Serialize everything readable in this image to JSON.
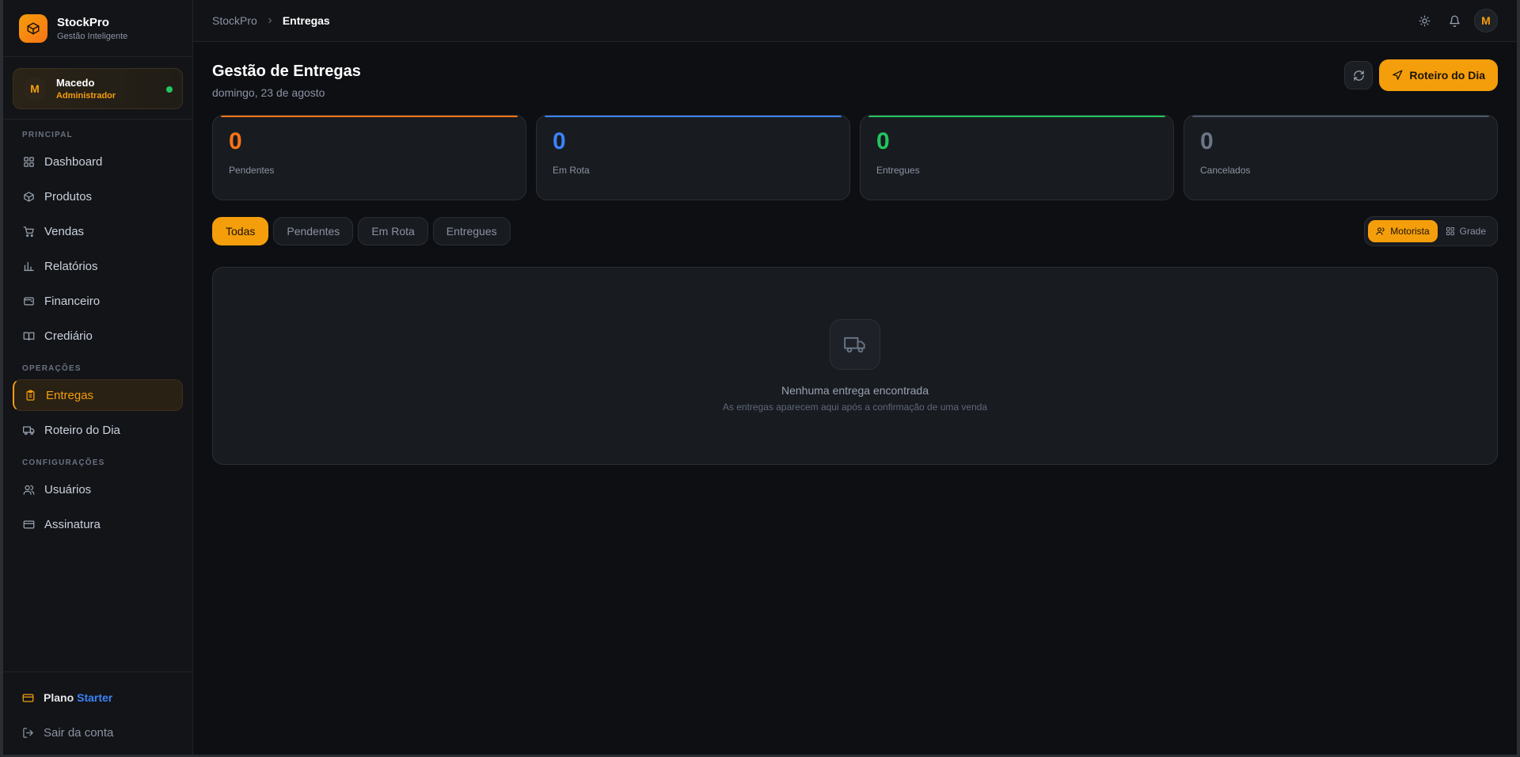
{
  "brand": {
    "name": "StockPro",
    "tagline": "Gestão Inteligente",
    "icon": "box-icon"
  },
  "user": {
    "initial": "M",
    "name": "Macedo",
    "role": "Administrador",
    "status_color": "#22c55e"
  },
  "sidebar": {
    "sections": [
      {
        "label": "PRINCIPAL"
      },
      {
        "label": "OPERAÇÕES"
      },
      {
        "label": "CONFIGURAÇÕES"
      }
    ],
    "items": [
      {
        "label": "Dashboard",
        "icon": "grid-icon"
      },
      {
        "label": "Produtos",
        "icon": "package-icon"
      },
      {
        "label": "Vendas",
        "icon": "cart-icon"
      },
      {
        "label": "Relatórios",
        "icon": "bar-chart-icon"
      },
      {
        "label": "Financeiro",
        "icon": "wallet-icon"
      },
      {
        "label": "Crediário",
        "icon": "book-icon"
      },
      {
        "label": "Entregas",
        "icon": "clipboard-icon",
        "active": true
      },
      {
        "label": "Roteiro do Dia",
        "icon": "truck-icon"
      },
      {
        "label": "Usuários",
        "icon": "users-icon"
      },
      {
        "label": "Assinatura",
        "icon": "credit-card-icon"
      }
    ],
    "plan": {
      "label": "Plano",
      "value": "Starter"
    },
    "logout": "Sair da conta"
  },
  "topbar": {
    "breadcrumb": [
      "StockPro",
      "Entregas"
    ],
    "avatar_initial": "M"
  },
  "page": {
    "title": "Gestão de Entregas",
    "date": "domingo, 23 de agosto",
    "primary_action": "Roteiro do Dia"
  },
  "stats": [
    {
      "value": "0",
      "label": "Pendentes",
      "color": "#f97316"
    },
    {
      "value": "0",
      "label": "Em Rota",
      "color": "#3b82f6"
    },
    {
      "value": "0",
      "label": "Entregues",
      "color": "#22c55e"
    },
    {
      "value": "0",
      "label": "Cancelados",
      "color": "#6b7686"
    }
  ],
  "filters": [
    "Todas",
    "Pendentes",
    "Em Rota",
    "Entregues"
  ],
  "active_filter": "Todas",
  "view_toggle": [
    "Motorista",
    "Grade"
  ],
  "active_view": "Motorista",
  "empty_state": {
    "title": "Nenhuma entrega encontrada",
    "subtitle": "As entregas aparecem aqui após a confirmação de uma venda"
  },
  "colors": {
    "accent": "#f59e0b",
    "background": "#0d0f13",
    "card": "#181b20"
  }
}
